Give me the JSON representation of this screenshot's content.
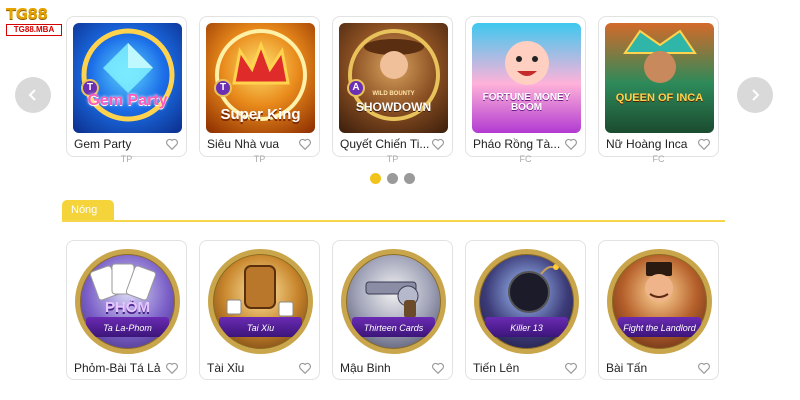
{
  "logo": {
    "brand": "TG88",
    "domain": "TG88.MBA"
  },
  "carousel": {
    "cards": [
      {
        "name": "Gem Party",
        "provider": "TP",
        "art_title": "Gem Party",
        "badge": "T"
      },
      {
        "name": "Siêu Nhà vua",
        "provider": "TP",
        "art_title": "Super King",
        "badge": "T"
      },
      {
        "name": "Quyết Chiến Ti...",
        "provider": "TP",
        "art_title": "SHOWDOWN",
        "art_subtitle": "WILD BOUNTY",
        "badge": "A"
      },
      {
        "name": "Pháo Rồng Tà...",
        "provider": "FC",
        "art_title": "FORTUNE MONEY BOOM"
      },
      {
        "name": "Nữ Hoàng Inca",
        "provider": "FC",
        "art_title": "QUEEN OF INCA"
      }
    ],
    "dots": {
      "count": 3,
      "active_index": 0
    }
  },
  "section": {
    "tab_label": "Nóng",
    "games": [
      {
        "name": "Phỏm-Bài Tá Lả",
        "art_title": "PHỎM",
        "banner": "Ta La-Phom"
      },
      {
        "name": "Tài Xỉu",
        "banner": "Tai Xiu"
      },
      {
        "name": "Mậu Binh",
        "banner": "Thirteen Cards"
      },
      {
        "name": "Tiến Lên",
        "banner": "Killer 13"
      },
      {
        "name": "Bài Tấn",
        "banner": "Fight the Landlord"
      }
    ]
  },
  "colors": {
    "accent": "#f5d33a",
    "dot_active": "#f2c31b",
    "dot_inactive": "#9a9a9a",
    "logo_red": "#d40000"
  },
  "icons": {
    "prev": "chevron-left-icon",
    "next": "chevron-right-icon",
    "favorite": "heart-outline-icon"
  }
}
